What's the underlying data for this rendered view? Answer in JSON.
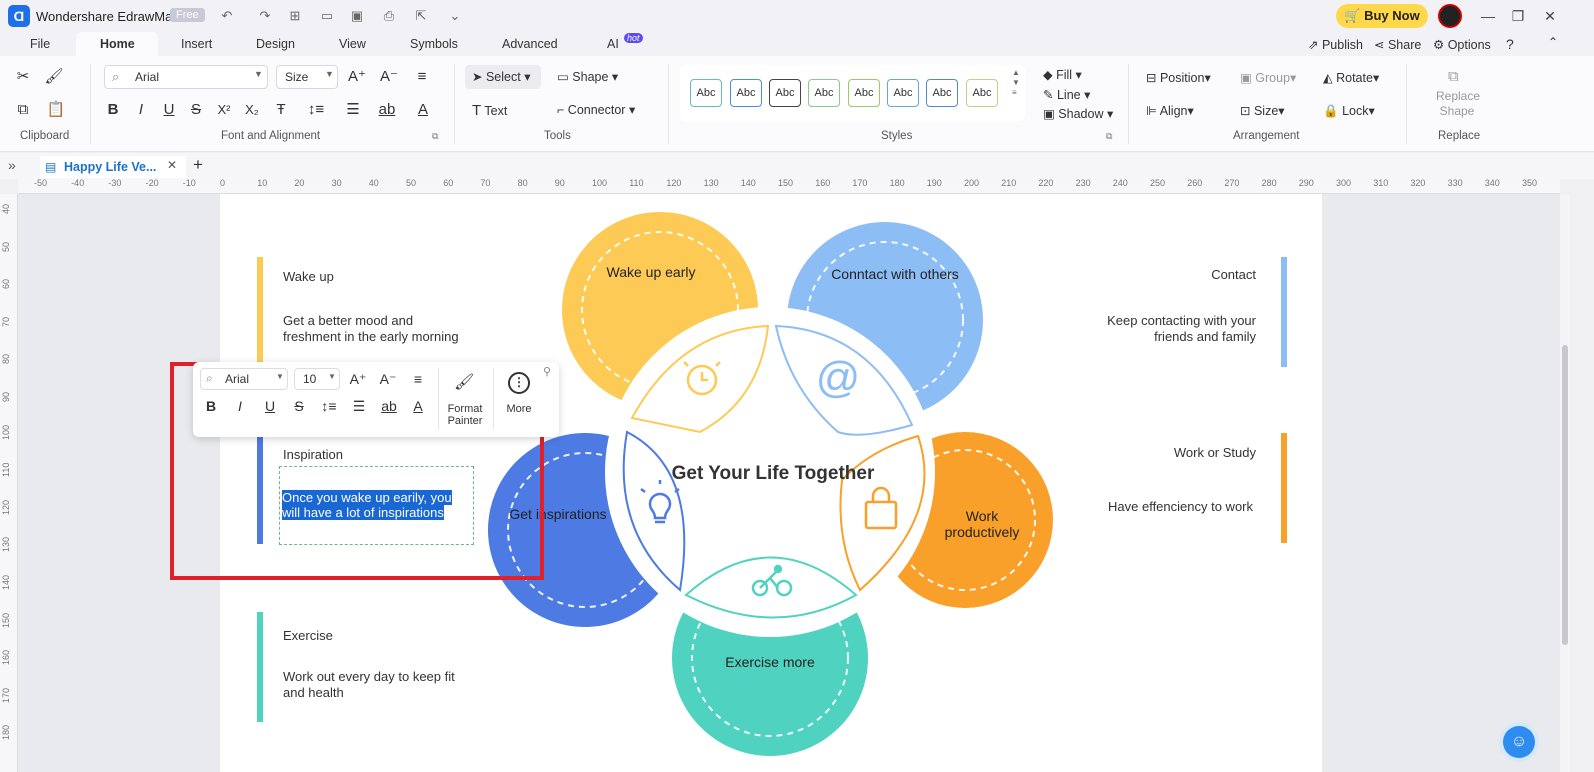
{
  "app": {
    "name": "Wondershare EdrawMax",
    "badge": "Free",
    "buy_now": "Buy Now"
  },
  "menu": [
    "File",
    "Home",
    "Insert",
    "Design",
    "View",
    "Symbols",
    "Advanced",
    "AI"
  ],
  "menu_hot": "hot",
  "right_links": {
    "publish": "Publish",
    "share": "Share",
    "options": "Options"
  },
  "ribbon": {
    "font": "Arial",
    "size": "Size",
    "select": "Select",
    "shape": "Shape",
    "text": "Text",
    "connector": "Connector",
    "style_label": "Abc",
    "fill": "Fill",
    "line": "Line",
    "shadow": "Shadow",
    "position": "Position",
    "group": "Group",
    "rotate": "Rotate",
    "align": "Align",
    "lock": "Lock",
    "replace_shape_1": "Replace",
    "replace_shape_2": "Shape",
    "groups": {
      "clipboard": "Clipboard",
      "font": "Font and Alignment",
      "tools": "Tools",
      "styles": "Styles",
      "arrangement": "Arrangement",
      "replace": "Replace"
    }
  },
  "doc_tab": "Happy Life Ve...",
  "ruler_h": [
    "-50",
    "-40",
    "-30",
    "-20",
    "-10",
    "0",
    "10",
    "20",
    "30",
    "40",
    "50",
    "60",
    "70",
    "80",
    "90",
    "100",
    "110",
    "120",
    "130",
    "140",
    "150",
    "160",
    "170",
    "180",
    "190",
    "200",
    "210",
    "220",
    "230",
    "240",
    "250",
    "260",
    "270",
    "280",
    "290",
    "300",
    "310",
    "320",
    "330",
    "340",
    "350"
  ],
  "ruler_v": [
    "40",
    "50",
    "60",
    "70",
    "80",
    "90",
    "100",
    "110",
    "120",
    "130",
    "140",
    "150",
    "160",
    "170",
    "180"
  ],
  "diagram": {
    "title": "Get Your Life Together",
    "petals": {
      "wake": "Wake up early",
      "contact": "Conntact with others",
      "work_1": "Work",
      "work_2": "productively",
      "exercise": "Exercise more",
      "inspiration": "Get inspirations"
    },
    "left": {
      "wake_title": "Wake up",
      "wake_desc_1": "Get a better mood and",
      "wake_desc_2": "freshment in the early morning",
      "insp_title": "Inspiration",
      "insp_desc_1": "Once you wake up earily, you",
      "insp_desc_2": "will have a lot of inspirations",
      "ex_title": "Exercise",
      "ex_desc_1": "Work out every day to keep fit",
      "ex_desc_2": "and health"
    },
    "right": {
      "contact_title": "Contact",
      "contact_desc_1": "Keep contacting with your",
      "contact_desc_2": "friends and family",
      "work_title": "Work or Study",
      "work_desc": "Have effenciency to work"
    },
    "colors": {
      "yellow": "#fdcb55",
      "blue_light": "#8dbdf5",
      "orange": "#f9a02a",
      "teal": "#4fd3c0",
      "blue": "#4d7be3"
    }
  },
  "float_toolbar": {
    "font": "Arial",
    "size": "10",
    "format_painter_1": "Format",
    "format_painter_2": "Painter",
    "more": "More"
  }
}
